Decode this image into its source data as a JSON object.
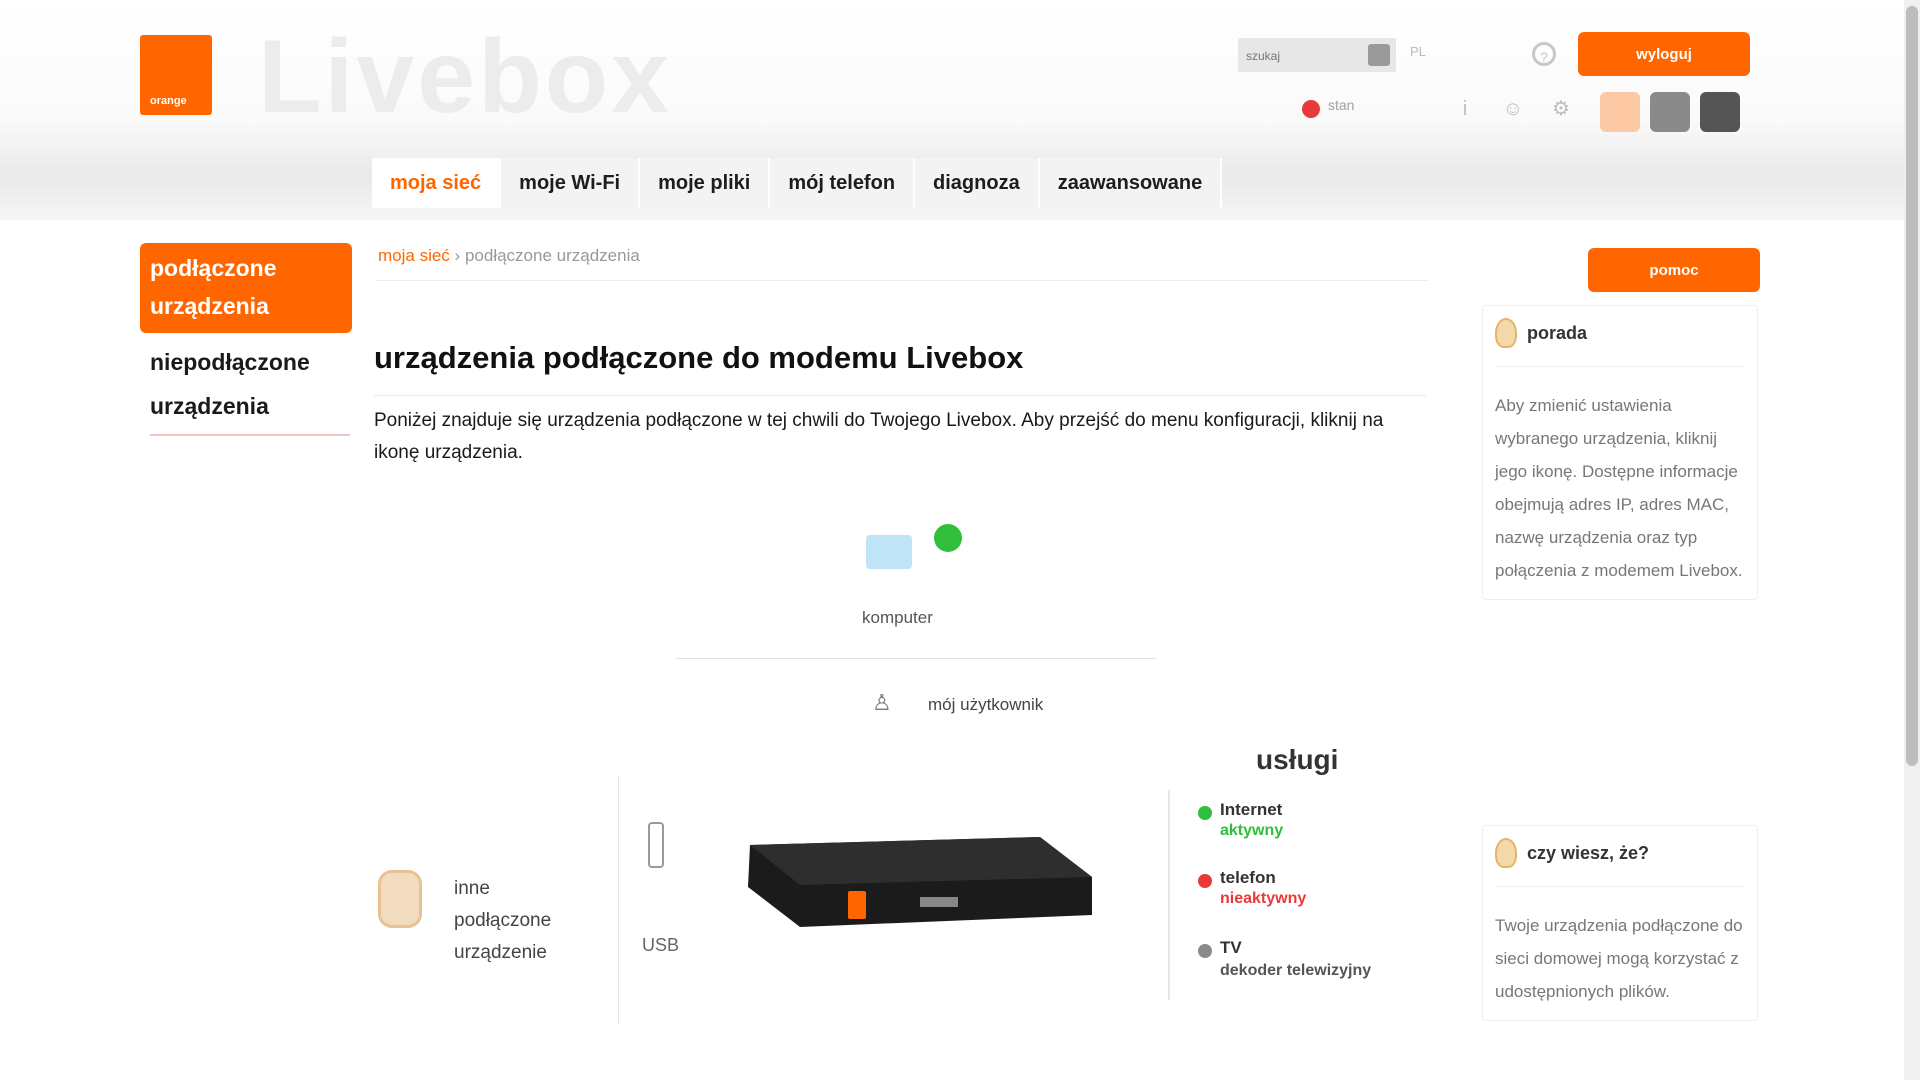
{
  "header": {
    "orange_logo_text": "orange",
    "brand": "Livebox",
    "search_placeholder": "szukaj",
    "language": "PL",
    "logout_label": "wyloguj",
    "status_text": "stan",
    "nav_tabs": [
      {
        "label": "moja sieć"
      },
      {
        "label": "moje Wi-Fi"
      },
      {
        "label": "moje pliki"
      },
      {
        "label": "mój telefon"
      },
      {
        "label": "diagnoza"
      },
      {
        "label": "zaawansowane"
      }
    ]
  },
  "sidebar": {
    "active_item": "podłączone urządzenia",
    "items": [
      {
        "label": "niepodłączone urządzenia"
      }
    ]
  },
  "breadcrumb": {
    "root": "moja sieć",
    "current": "podłączone urządzenia"
  },
  "main": {
    "title": "urządzenia podłączone do modemu Livebox",
    "intro": "Poniżej znajduje się urządzenia podłączone w tej chwili do Twojego Livebox. Aby przejść do menu konfiguracji, kliknij na ikonę urządzenia.",
    "diagram": {
      "top_device_label": "komputer",
      "user_label": "mój użytkownik",
      "side_device_label": "inne podłączone urządzenie",
      "usb_label": "USB",
      "ports_title": "usługi",
      "ports": [
        {
          "name": "Internet",
          "status": "aktywny",
          "color": "#2fbf3a"
        },
        {
          "name": "telefon",
          "status": "nieaktywny",
          "color": "#e83a3a"
        },
        {
          "name": "TV",
          "status": "dekoder telewizyjny",
          "color": "#8a8a8a"
        }
      ]
    }
  },
  "right_panel": {
    "help_label": "pomoc",
    "tip_title": "porada",
    "tip_text": "Aby zmienić ustawienia wybranego urządzenia, kliknij jego ikonę. Dostępne informacje obejmują adres IP, adres MAC, nazwę urządzenia oraz typ połączenia z modemem Livebox.",
    "tip2_title": "czy wiesz, że?",
    "tip2_text": "Twoje urządzenia podłączone do sieci domowej mogą korzystać z udostępnionych plików."
  },
  "colors": {
    "accent": "#ff6600",
    "ok": "#2fbf3a",
    "error": "#e83a3a"
  }
}
